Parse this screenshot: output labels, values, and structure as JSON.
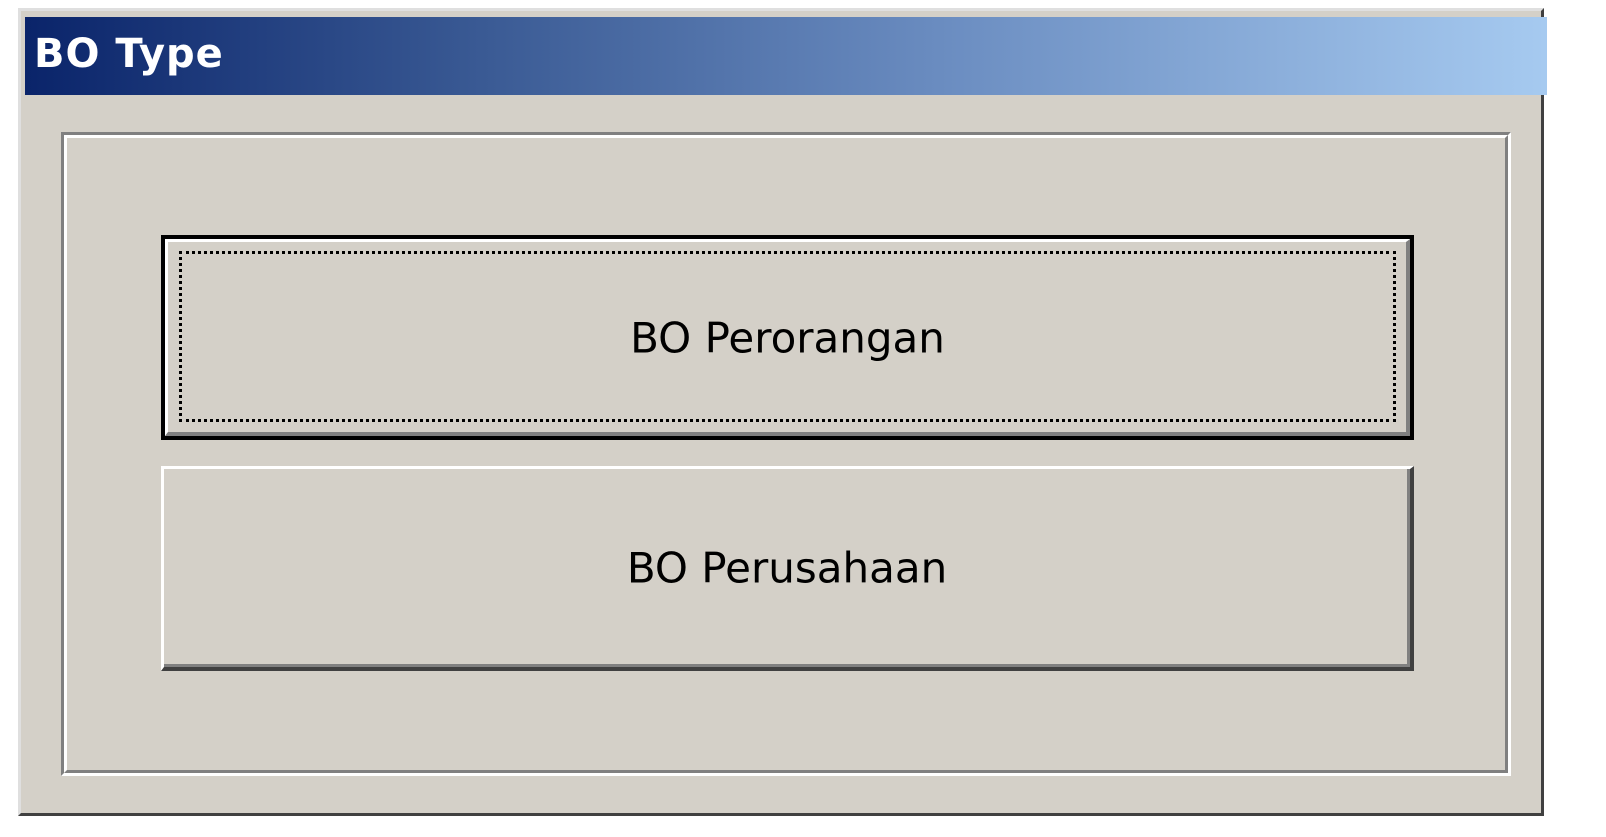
{
  "window": {
    "title": "BO Type"
  },
  "buttons": {
    "individual_label": "BO Perorangan",
    "company_label": "BO Perusahaan"
  },
  "colors": {
    "face": "#d4d0c8",
    "title_gradient_start": "#0a246a",
    "title_gradient_end": "#a6caf0",
    "title_text": "#ffffff"
  }
}
